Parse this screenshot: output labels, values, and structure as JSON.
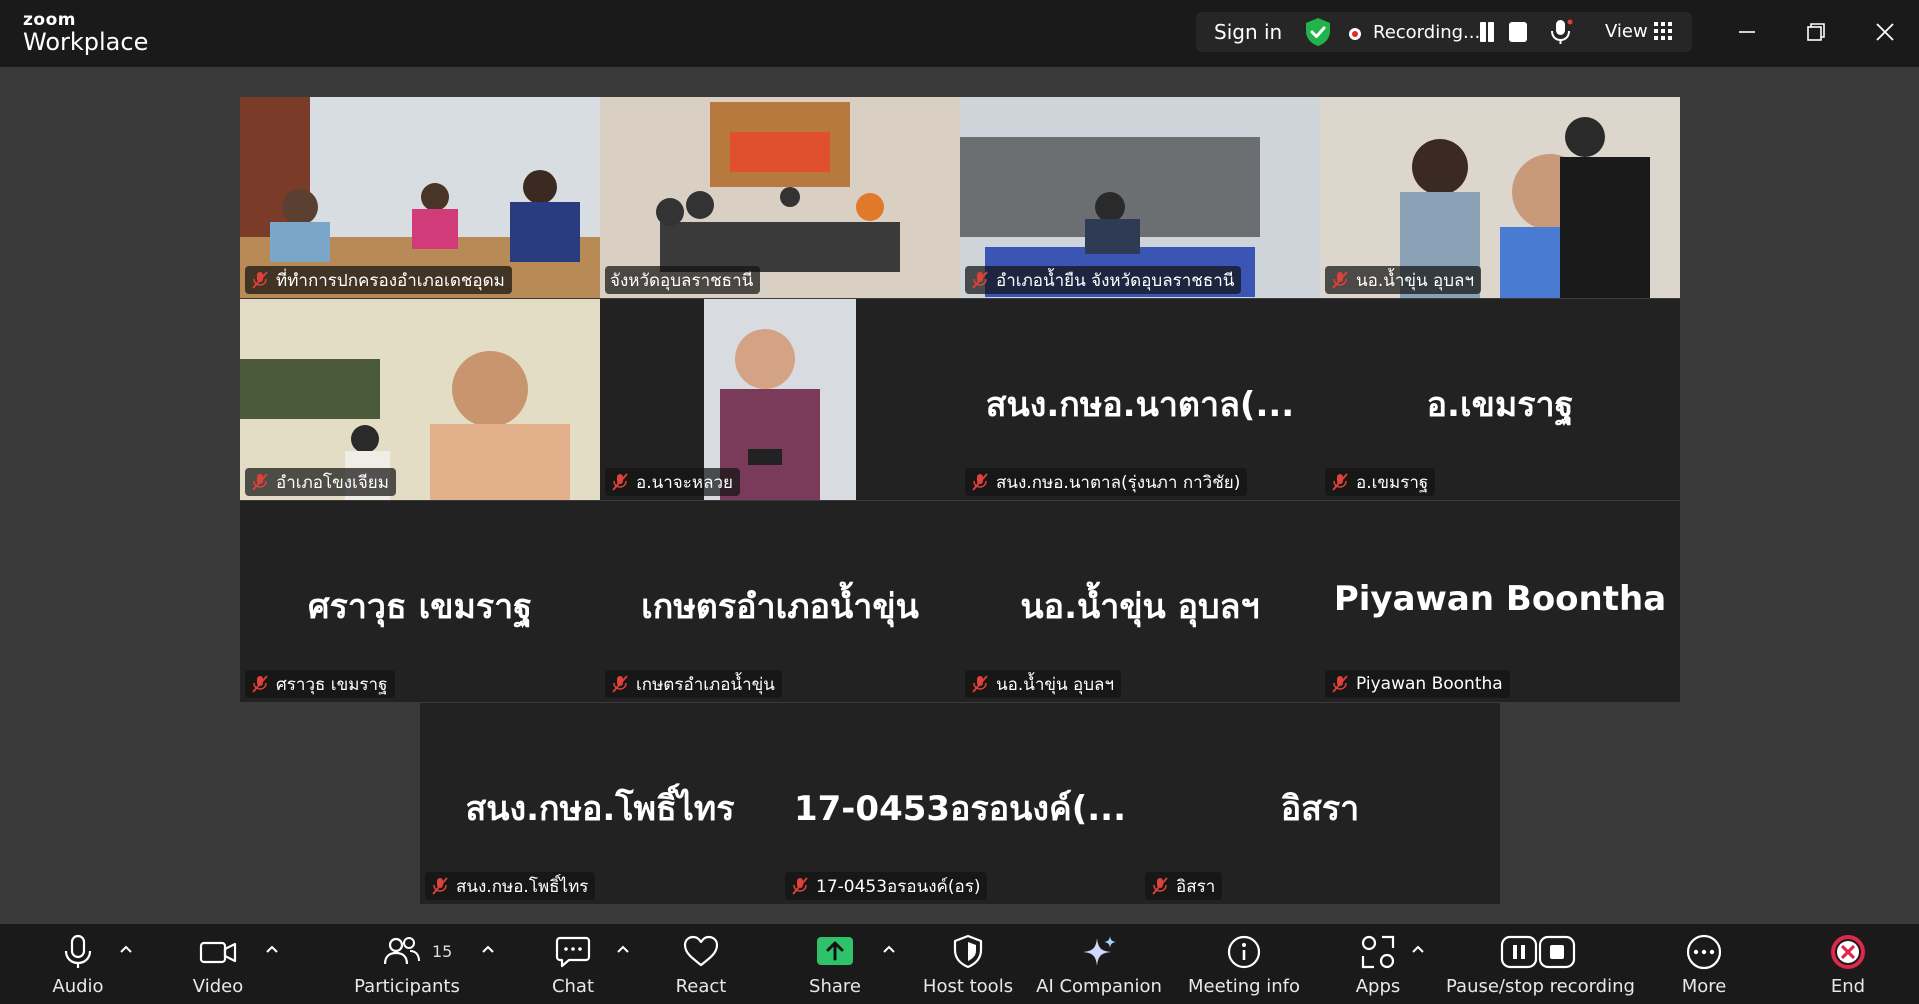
{
  "app": {
    "brand_small": "zoom",
    "brand_big": "Workplace"
  },
  "topbar": {
    "sign_in": "Sign in",
    "recording": "Recording...",
    "view": "View"
  },
  "tiles": [
    {
      "label": "ที่ทำการปกครองอำเภอเดชอุดม",
      "placeholder": ""
    },
    {
      "label": "จังหวัดอุบลราชธานี",
      "placeholder": ""
    },
    {
      "label": "อำเภอน้ำยืน จังหวัดอุบลราชธานี",
      "placeholder": ""
    },
    {
      "label": "นอ.น้ำขุ่น อุบลฯ",
      "placeholder": ""
    },
    {
      "label": "อำเภอโขงเจียม",
      "placeholder": ""
    },
    {
      "label": "อ.นาจะหลวย",
      "placeholder": ""
    },
    {
      "label": "สนง.กษอ.นาตาล(รุ่งนภา กาวิชัย)",
      "placeholder": "สนง.กษอ.นาตาล(..."
    },
    {
      "label": "อ.เขมราฐ",
      "placeholder": "อ.เขมราฐ"
    },
    {
      "label": "ศราวุธ เขมราฐ",
      "placeholder": "ศราวุธ เขมราฐ"
    },
    {
      "label": "เกษตรอำเภอน้ำขุ่น",
      "placeholder": "เกษตรอำเภอน้ำขุ่น"
    },
    {
      "label": "นอ.น้ำขุ่น อุบลฯ",
      "placeholder": "นอ.น้ำขุ่น อุบลฯ"
    },
    {
      "label": "Piyawan Boontha",
      "placeholder": "Piyawan Boontha"
    },
    {
      "label": "สนง.กษอ.โพธิ์ไทร",
      "placeholder": "สนง.กษอ.โพธิ์ไทร"
    },
    {
      "label": "17-0453อรอนงค์(อร)",
      "placeholder": "17-0453อรอนงค์(..."
    },
    {
      "label": "อิสรา",
      "placeholder": "อิสรา"
    }
  ],
  "toolbar": {
    "audio": "Audio",
    "video": "Video",
    "participants": "Participants",
    "participant_count": "15",
    "chat": "Chat",
    "react": "React",
    "share": "Share",
    "host_tools": "Host tools",
    "ai_companion": "AI Companion",
    "meeting_info": "Meeting info",
    "apps": "Apps",
    "pause_stop": "Pause/stop recording",
    "more": "More",
    "end": "End"
  },
  "colors": {
    "share_green": "#2ec26a",
    "active_speaker": "#3ee07c",
    "muted_red": "#e0413a",
    "end_red": "#e0274b"
  }
}
